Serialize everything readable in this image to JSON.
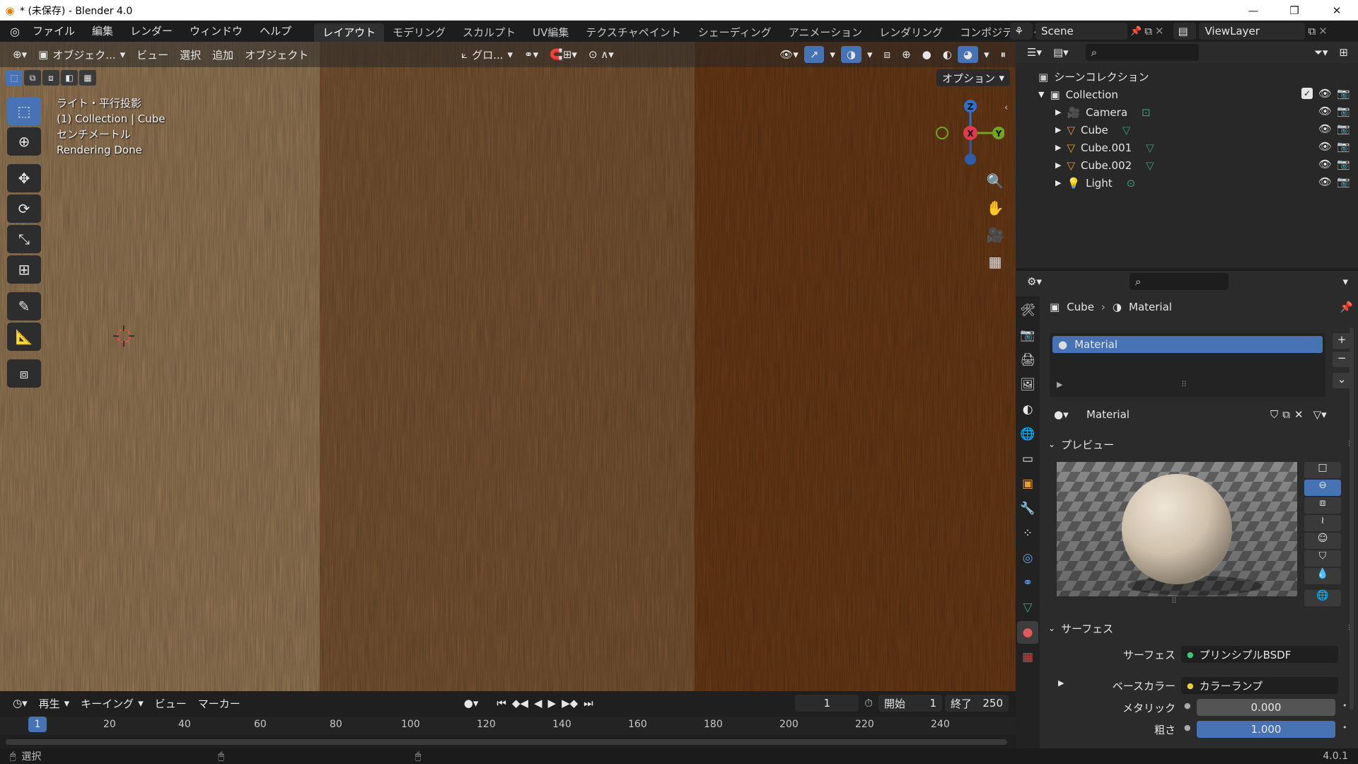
{
  "titlebar": {
    "title": "* (未保存) - Blender 4.0",
    "logo_icon": "blender-logo-icon",
    "minimize": "—",
    "maximize": "❐",
    "close": "✕"
  },
  "menu": {
    "items": [
      "ファイル",
      "編集",
      "レンダー",
      "ウィンドウ",
      "ヘルプ"
    ]
  },
  "workspaces": {
    "tabs": [
      "レイアウト",
      "モデリング",
      "スカルプト",
      "UV編集",
      "テクスチャペイント",
      "シェーディング",
      "アニメーション",
      "レンダリング",
      "コンポジティング"
    ],
    "active": "レイアウト"
  },
  "scene": {
    "label": "Scene",
    "view_layer": "ViewLayer"
  },
  "viewport_header": {
    "mode": "オブジェク...",
    "view": "ビュー",
    "select": "選択",
    "add": "追加",
    "object": "オブジェクト",
    "transform_orientation": "グロ...",
    "options": "オプション"
  },
  "viewport_overlay": {
    "line1": "ライト・平行投影",
    "line2": "(1) Collection | Cube",
    "line3": "センチメートル",
    "line4": "Rendering Done"
  },
  "gizmo": {
    "x": "X",
    "y": "Y",
    "z": "Z"
  },
  "timeline": {
    "play_menu": "再生",
    "keying_menu": "キーイング",
    "view": "ビュー",
    "marker": "マーカー",
    "current_frame": "1",
    "start_label": "開始",
    "start": "1",
    "end_label": "終了",
    "end": "250",
    "ticks": [
      "1",
      "20",
      "40",
      "60",
      "80",
      "100",
      "120",
      "140",
      "160",
      "180",
      "200",
      "220",
      "240"
    ]
  },
  "statusbar": {
    "select": "選択",
    "version": "4.0.1"
  },
  "outliner": {
    "scene_collection": "シーンコレクション",
    "collection": "Collection",
    "objects": [
      {
        "name": "Camera",
        "icon": "camera-icon",
        "color": "#e89c35"
      },
      {
        "name": "Cube",
        "icon": "mesh-icon",
        "color": "#e89c35"
      },
      {
        "name": "Cube.001",
        "icon": "mesh-icon",
        "color": "#e89c35"
      },
      {
        "name": "Cube.002",
        "icon": "mesh-icon",
        "color": "#e89c35"
      },
      {
        "name": "Light",
        "icon": "light-icon",
        "color": "#e89c35"
      }
    ]
  },
  "properties": {
    "breadcrumb_object": "Cube",
    "breadcrumb_material": "Material",
    "slot_name": "Material",
    "material_name": "Material",
    "preview_label": "プレビュー",
    "surface_panel": "サーフェス",
    "surface_label": "サーフェス",
    "surface_value": "プリンシプルBSDF",
    "base_color_label": "ベースカラー",
    "base_color_value": "カラーランプ",
    "metallic_label": "メタリック",
    "metallic_value": "0.000",
    "roughness_label": "粗さ",
    "roughness_value": "1.000",
    "roughness_fraction": 1.0
  },
  "colors": {
    "accent": "#4772b3",
    "bg": "#1d1d1d",
    "panel": "#2b2b2b",
    "wood_light": "#9a7a55",
    "wood_mid": "#7a5532",
    "wood_dark": "#6a3a16"
  }
}
